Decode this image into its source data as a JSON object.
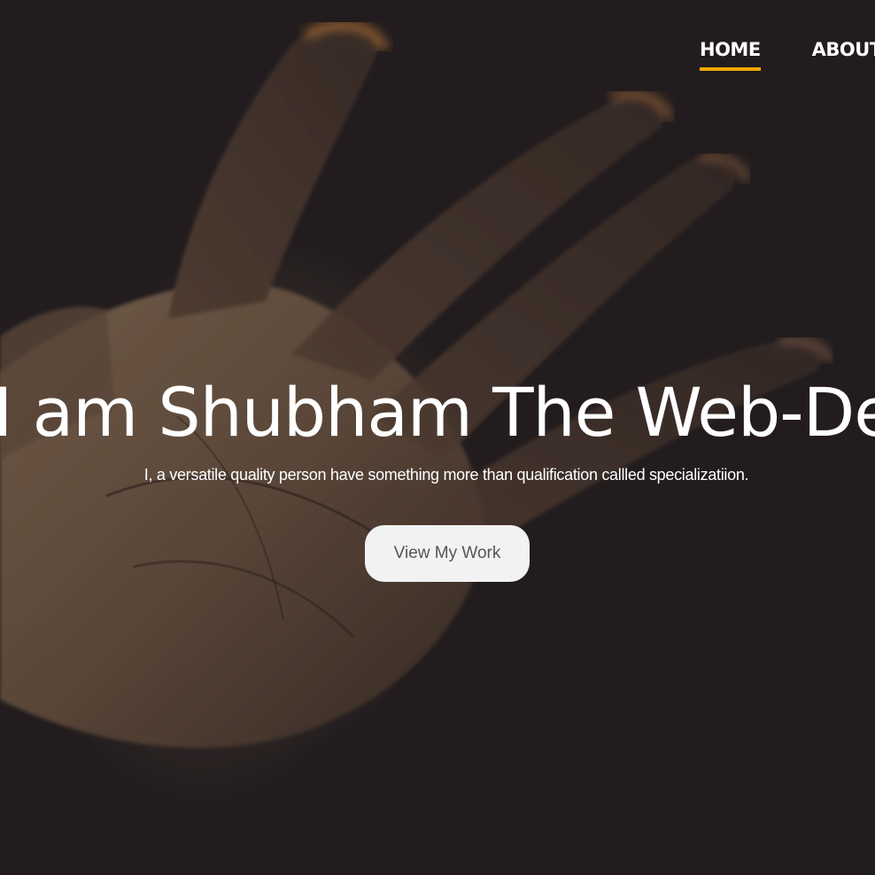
{
  "nav": {
    "items": [
      {
        "label": "HOME",
        "active": true
      },
      {
        "label": "ABOUT",
        "active": false
      }
    ],
    "accent_color": "#f5a800"
  },
  "hero": {
    "title": "I am Shubham The Web-Designer",
    "subtitle": "I, a versatile quality person have something more than qualification callled specializatiion.",
    "cta_label": "View My Work",
    "background_image": "open-palm-photo"
  }
}
